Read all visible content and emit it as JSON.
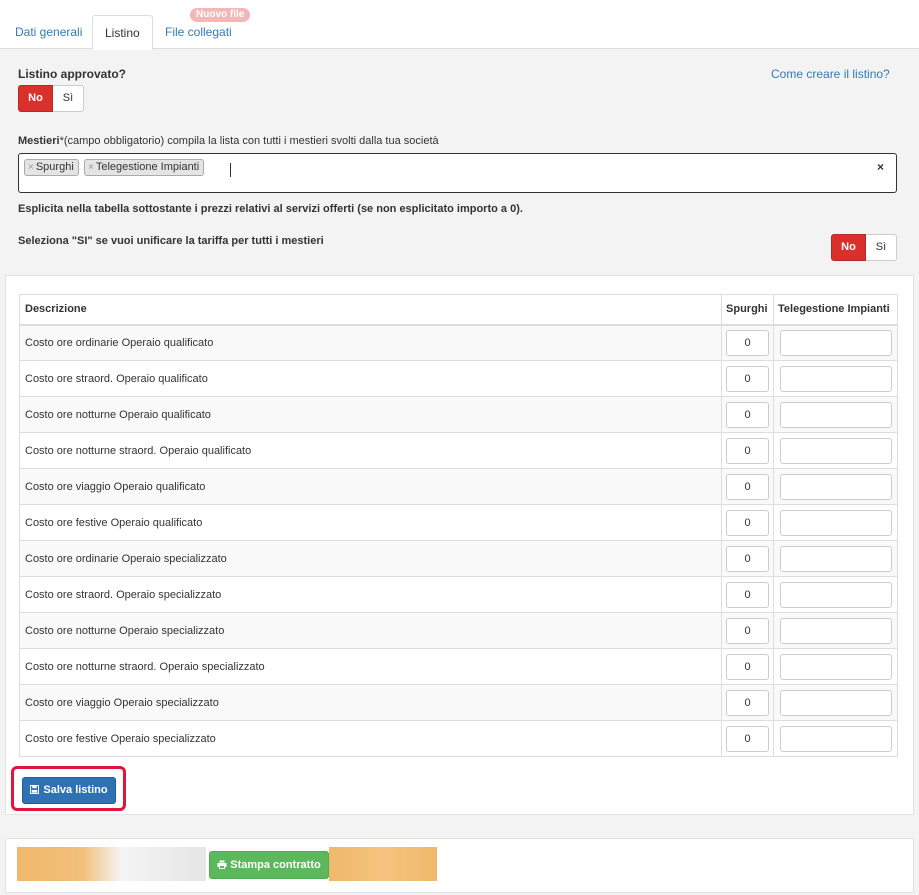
{
  "tabs": [
    {
      "label": "Dati generali",
      "active": false
    },
    {
      "label": "Listino",
      "active": true
    },
    {
      "label": "File collegati",
      "active": false,
      "badge": "Nuovo file"
    }
  ],
  "listino_approvato": {
    "label": "Listino approvato?",
    "options": [
      "No",
      "Sì"
    ],
    "selected": "No",
    "help_link": "Come creare il listino?"
  },
  "mestieri": {
    "label_bold": "Mestieri",
    "label_rest": "*(campo obbligatorio) compila la lista con tutti i mestieri svolti dalla tua società",
    "tags": [
      "Spurghi",
      "Telegestione Impianti"
    ],
    "clear_symbol": "×",
    "tag_remove_symbol": "×"
  },
  "explicit_note": "Esplicita nella tabella sottostante i prezzi relativi al servizi offerti (se non esplicitato importo a 0).",
  "unify": {
    "label": "Seleziona \"SI\" se vuoi unificare la tariffa per tutti i mestieri",
    "options": [
      "No",
      "Sì"
    ],
    "selected": "No"
  },
  "price_table": {
    "headers": [
      "Descrizione",
      "Spurghi",
      "Telegestione Impianti"
    ],
    "rows": [
      {
        "desc": "Costo ore ordinarie Operaio qualificato",
        "spurghi": "0",
        "telegestione": ""
      },
      {
        "desc": "Costo ore straord. Operaio qualificato",
        "spurghi": "0",
        "telegestione": ""
      },
      {
        "desc": "Costo ore notturne Operaio qualificato",
        "spurghi": "0",
        "telegestione": ""
      },
      {
        "desc": "Costo ore notturne straord. Operaio qualificato",
        "spurghi": "0",
        "telegestione": ""
      },
      {
        "desc": "Costo ore viaggio Operaio qualificato",
        "spurghi": "0",
        "telegestione": ""
      },
      {
        "desc": "Costo ore festive Operaio qualificato",
        "spurghi": "0",
        "telegestione": ""
      },
      {
        "desc": "Costo ore ordinarie Operaio specializzato",
        "spurghi": "0",
        "telegestione": ""
      },
      {
        "desc": "Costo ore straord. Operaio specializzato",
        "spurghi": "0",
        "telegestione": ""
      },
      {
        "desc": "Costo ore notturne Operaio specializzato",
        "spurghi": "0",
        "telegestione": ""
      },
      {
        "desc": "Costo ore notturne straord. Operaio specializzato",
        "spurghi": "0",
        "telegestione": ""
      },
      {
        "desc": "Costo ore viaggio Operaio specializzato",
        "spurghi": "0",
        "telegestione": ""
      },
      {
        "desc": "Costo ore festive Operaio specializzato",
        "spurghi": "0",
        "telegestione": ""
      }
    ]
  },
  "buttons": {
    "save": "Salva listino",
    "print": "Stampa contratto"
  },
  "icons": {
    "save": "floppy-disk-icon",
    "print": "printer-icon"
  },
  "colors": {
    "primary": "#2f72b3",
    "danger": "#d9302c",
    "success": "#5cb85c",
    "highlight": "#e0143c",
    "link": "#337ab7"
  }
}
